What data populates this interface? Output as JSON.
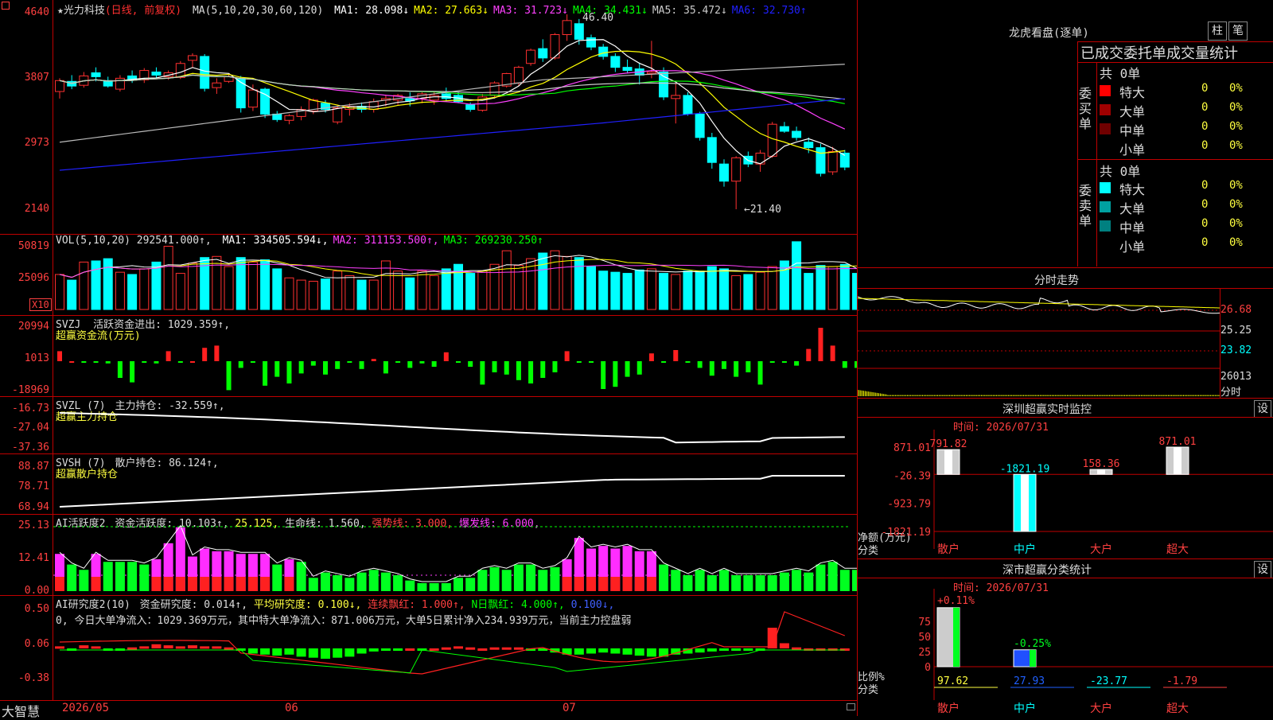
{
  "stock": {
    "name": "★光力科技",
    "mode": "(日线, 前复权)"
  },
  "price_panel": {
    "ma_label": "MA(5,10,20,30,60,120)",
    "ma": [
      {
        "label": "MA1:",
        "value": "28.098↓",
        "color": "#ffffff"
      },
      {
        "label": "MA2:",
        "value": "27.663↓",
        "color": "#ffff00"
      },
      {
        "label": "MA3:",
        "value": "31.723↓",
        "color": "#ff40ff"
      },
      {
        "label": "MA4:",
        "value": "34.431↓",
        "color": "#00ff00"
      },
      {
        "label": "MA5:",
        "value": "35.472↓",
        "color": "#cccccc"
      },
      {
        "label": "MA6:",
        "value": "32.730↑",
        "color": "#2020ff"
      }
    ],
    "y_ticks": [
      "4640",
      "3807",
      "2973",
      "2140"
    ],
    "high_label": "46.40",
    "low_label": "←21.40",
    "candles": [
      [
        36.5,
        38.2,
        35.6,
        37.9
      ],
      [
        37.8,
        38.6,
        36.8,
        37.2
      ],
      [
        37.3,
        39.0,
        37.0,
        38.5
      ],
      [
        38.9,
        39.6,
        37.8,
        38.4
      ],
      [
        37.9,
        38.4,
        37.0,
        37.2
      ],
      [
        36.8,
        38.6,
        36.5,
        38.2
      ],
      [
        38.5,
        39.2,
        37.6,
        38.0
      ],
      [
        38.0,
        39.5,
        37.6,
        39.2
      ],
      [
        39.0,
        39.6,
        38.2,
        38.6
      ],
      [
        38.4,
        39.2,
        38.0,
        38.9
      ],
      [
        38.3,
        40.4,
        38.1,
        40.1
      ],
      [
        40.5,
        41.4,
        39.5,
        41.1
      ],
      [
        41.0,
        41.3,
        36.5,
        36.9
      ],
      [
        37.0,
        38.2,
        36.2,
        37.6
      ],
      [
        37.8,
        38.8,
        37.6,
        38.4
      ],
      [
        38.2,
        38.5,
        33.8,
        34.4
      ],
      [
        34.5,
        37.4,
        34.0,
        36.7
      ],
      [
        36.8,
        37.0,
        33.1,
        33.6
      ],
      [
        33.6,
        34.0,
        32.6,
        32.9
      ],
      [
        32.8,
        33.6,
        32.3,
        33.4
      ],
      [
        33.3,
        34.6,
        32.8,
        34.2
      ],
      [
        34.0,
        35.6,
        33.6,
        35.4
      ],
      [
        35.0,
        35.4,
        33.8,
        34.2
      ],
      [
        32.6,
        34.8,
        32.3,
        34.4
      ],
      [
        34.2,
        35.0,
        33.4,
        34.6
      ],
      [
        34.6,
        35.1,
        33.8,
        34.2
      ],
      [
        34.2,
        35.6,
        33.8,
        35.2
      ],
      [
        35.4,
        36.1,
        34.6,
        35.6
      ],
      [
        35.4,
        36.2,
        34.8,
        36.0
      ],
      [
        35.6,
        36.4,
        34.6,
        35.3
      ],
      [
        35.6,
        36.4,
        35.0,
        36.2
      ],
      [
        35.4,
        36.5,
        34.8,
        36.0
      ],
      [
        36.2,
        37.0,
        35.2,
        35.6
      ],
      [
        36.0,
        36.4,
        35.0,
        35.2
      ],
      [
        34.8,
        35.1,
        33.9,
        34.2
      ],
      [
        34.1,
        36.2,
        33.9,
        35.8
      ],
      [
        36.0,
        37.8,
        35.6,
        37.6
      ],
      [
        37.2,
        38.9,
        37.0,
        38.8
      ],
      [
        37.6,
        39.8,
        37.2,
        39.6
      ],
      [
        40.1,
        42.0,
        39.8,
        41.8
      ],
      [
        42.0,
        43.2,
        40.3,
        40.8
      ],
      [
        40.8,
        44.0,
        40.6,
        43.8
      ],
      [
        43.8,
        46.4,
        43.0,
        45.6
      ],
      [
        45.2,
        45.8,
        42.5,
        43.2
      ],
      [
        43.4,
        43.8,
        41.8,
        42.2
      ],
      [
        42.2,
        42.6,
        40.6,
        41.0
      ],
      [
        41.0,
        41.4,
        39.0,
        39.6
      ],
      [
        39.6,
        40.6,
        38.8,
        39.2
      ],
      [
        39.4,
        40.2,
        37.4,
        38.6
      ],
      [
        38.8,
        43.0,
        38.2,
        39.0
      ],
      [
        39.0,
        39.6,
        35.4,
        35.8
      ],
      [
        35.6,
        37.6,
        32.4,
        36.0
      ],
      [
        36.0,
        36.4,
        33.4,
        33.6
      ],
      [
        33.6,
        33.9,
        30.2,
        30.6
      ],
      [
        30.6,
        31.2,
        26.6,
        27.4
      ],
      [
        27.2,
        27.8,
        24.3,
        25.0
      ],
      [
        25.0,
        28.2,
        21.4,
        28.0
      ],
      [
        28.2,
        28.8,
        26.8,
        27.2
      ],
      [
        27.2,
        29.0,
        26.2,
        28.6
      ],
      [
        28.2,
        32.6,
        28.0,
        32.3
      ],
      [
        32.0,
        32.6,
        31.2,
        31.4
      ],
      [
        31.4,
        32.0,
        30.2,
        30.6
      ],
      [
        30.0,
        30.6,
        28.6,
        29.3
      ],
      [
        29.3,
        29.8,
        25.6,
        26.0
      ],
      [
        26.2,
        29.4,
        25.8,
        28.8
      ],
      [
        28.6,
        29.0,
        26.4,
        26.8
      ]
    ]
  },
  "vol_panel": {
    "title": "VOL(5,10,20)",
    "value": "292541.000↑,",
    "ma": [
      {
        "label": "MA1:",
        "value": "334505.594↓,",
        "color": "#ffffff"
      },
      {
        "label": "MA2:",
        "value": "311153.500↑,",
        "color": "#ff40ff"
      },
      {
        "label": "MA3:",
        "value": "269230.250↑",
        "color": "#00ff00"
      }
    ],
    "y_ticks": [
      "50819",
      "25096"
    ],
    "unit": "X10",
    "values": [
      310,
      260,
      420,
      430,
      450,
      330,
      310,
      360,
      420,
      560,
      320,
      410,
      460,
      470,
      380,
      460,
      420,
      440,
      360,
      280,
      260,
      250,
      270,
      340,
      300,
      260,
      260,
      430,
      340,
      280,
      340,
      300,
      360,
      400,
      320,
      340,
      400,
      520,
      390,
      450,
      500,
      520,
      470,
      460,
      380,
      340,
      330,
      320,
      350,
      360,
      320,
      310,
      340,
      340,
      380,
      360,
      300,
      310,
      330,
      380,
      430,
      600,
      320,
      390,
      380,
      400,
      320
    ]
  },
  "svzj_panel": {
    "title": "SVZJ",
    "label": "活跃资金进出:",
    "value": "1029.359↑,",
    "sublabel": "超赢资金流(万元)",
    "y_ticks": [
      "20994",
      "1013",
      "-18969"
    ],
    "values": [
      9,
      0,
      -1,
      -1,
      -2,
      -15,
      -19,
      -1,
      -2,
      9,
      -1,
      0,
      12,
      14,
      -26,
      -6,
      -1,
      -22,
      -14,
      -20,
      -11,
      -4,
      -12,
      -7,
      -1,
      -7,
      2,
      -11,
      -1,
      -6,
      -2,
      -5,
      8,
      -1,
      -5,
      -21,
      -10,
      -12,
      -17,
      -20,
      -15,
      -10,
      9,
      -1,
      -1,
      -25,
      -23,
      -14,
      -12,
      7,
      -1,
      10,
      -1,
      -6,
      -13,
      -7,
      -14,
      -10,
      -21,
      -1,
      -1,
      -4,
      11,
      30,
      14,
      -6,
      -6,
      -7,
      -4
    ]
  },
  "svzl_panel": {
    "title": "SVZL (7)",
    "label": "主力持仓:",
    "value": "-32.559↑,",
    "sublabel": "超赢主力持仓",
    "y_ticks": [
      "-16.73",
      "-27.04",
      "-37.36"
    ]
  },
  "svsh_panel": {
    "title": "SVSH (7)",
    "label": "散户持仓:",
    "value": "86.124↑,",
    "sublabel": "超赢散户持仓",
    "y_ticks": [
      "88.87",
      "78.71",
      "68.94"
    ]
  },
  "ai_active": {
    "title": "AI活跃度2",
    "label": "资金活跃度:",
    "value": "10.103↑,",
    "v2": "25.125,",
    "life_label": "生命线:",
    "life_value": "1.560,",
    "strong_label": "强势线:",
    "strong_value": "3.000,",
    "burst_label": "爆发线:",
    "burst_value": "6.000,",
    "y_ticks": [
      "25.13",
      "12.41",
      "0.00"
    ],
    "values": [
      14,
      10,
      8,
      14,
      11,
      11,
      11,
      10,
      12,
      18,
      24,
      13,
      16,
      15,
      15,
      14,
      14,
      14,
      10,
      12,
      11,
      5,
      7,
      6,
      5,
      7,
      8,
      7,
      6,
      4,
      3,
      3,
      3,
      5,
      5,
      8,
      9,
      8,
      10,
      10,
      8,
      9,
      12,
      20,
      16,
      17,
      16,
      17,
      15,
      15,
      10,
      8,
      6,
      8,
      6,
      8,
      6,
      6,
      6,
      6,
      7,
      8,
      7,
      10,
      11,
      8,
      8,
      8,
      9
    ]
  },
  "ai_research": {
    "title": "AI研究度2(10)",
    "label": "资金研究度:",
    "value": "0.014↑,",
    "avg_label": "平均研究度:",
    "avg_value": "0.100↓,",
    "red_label": "连续飘红:",
    "red_value": "1.000↑,",
    "n_label": "N日飘红:",
    "n_value": "4.000↑,",
    "blue_value": "0.100↓,",
    "summary": "0, 今日大单净流入：1029.369万元，其中特大单净流入：871.006万元，大单5日累计净入234.939万元，当前主力控盘弱",
    "y_ticks": [
      "0.50",
      "0.06",
      "-0.38"
    ]
  },
  "bottom_bar": {
    "app": "大智慧",
    "dates": [
      "2026/05",
      "06",
      "07"
    ]
  },
  "dragon_tiger": {
    "title": "龙虎看盘(逐单)",
    "tab_bar": "柱",
    "tab_stroke": "笔",
    "section_header": "已成交委托单成交量统计",
    "buy_side": {
      "label": "委买单",
      "count": "共 0单",
      "rows": [
        {
          "name": "特大",
          "count": "0",
          "pct": "0%",
          "color": "#ff0000"
        },
        {
          "name": "大单",
          "count": "0",
          "pct": "0%",
          "color": "#a00000"
        },
        {
          "name": "中单",
          "count": "0",
          "pct": "0%",
          "color": "#700000"
        },
        {
          "name": "小单",
          "count": "0",
          "pct": "0%",
          "color": ""
        }
      ]
    },
    "sell_side": {
      "label": "委卖单",
      "count": "共 0单",
      "rows": [
        {
          "name": "特大",
          "count": "0",
          "pct": "0%",
          "color": "#00ffff"
        },
        {
          "name": "大单",
          "count": "0",
          "pct": "0%",
          "color": "#00a0a0"
        },
        {
          "name": "中单",
          "count": "0",
          "pct": "0%",
          "color": "#008080"
        },
        {
          "name": "小单",
          "count": "0",
          "pct": "0%",
          "color": ""
        }
      ]
    }
  },
  "intraday": {
    "title": "分时走势",
    "ticks": [
      "26.68",
      "25.25",
      "23.82"
    ],
    "vol_tick": "26013",
    "vol_label": "分时"
  },
  "sz_monitor": {
    "title": "深圳超赢实时监控",
    "set_label": "设",
    "time": "时间: 2026/07/31",
    "y_ticks": [
      "871.01",
      "-26.39",
      "-923.79",
      "-1821.19"
    ],
    "unit": "净额(万元)",
    "category_label": "分类",
    "chart_data": {
      "type": "bar",
      "categories": [
        "散户",
        "中户",
        "大户",
        "超大"
      ],
      "values": [
        791.82,
        -1821.19,
        158.36,
        871.01
      ],
      "labels": [
        "791.82",
        "-1821.19",
        "158.36",
        "871.01"
      ]
    }
  },
  "sz_classify": {
    "title": "深市超赢分类统计",
    "set_label": "设",
    "time": "时间: 2026/07/31",
    "y_ticks": [
      "75",
      "50",
      "25",
      "0"
    ],
    "unit": "比例%",
    "category_label": "分类",
    "chart_data": {
      "type": "bar",
      "categories": [
        "散户",
        "中户",
        "大户",
        "超大"
      ],
      "values": [
        97.62,
        27.93,
        -23.77,
        -1.79
      ],
      "top_labels": [
        "+0.11%",
        "-0.25%"
      ]
    }
  }
}
